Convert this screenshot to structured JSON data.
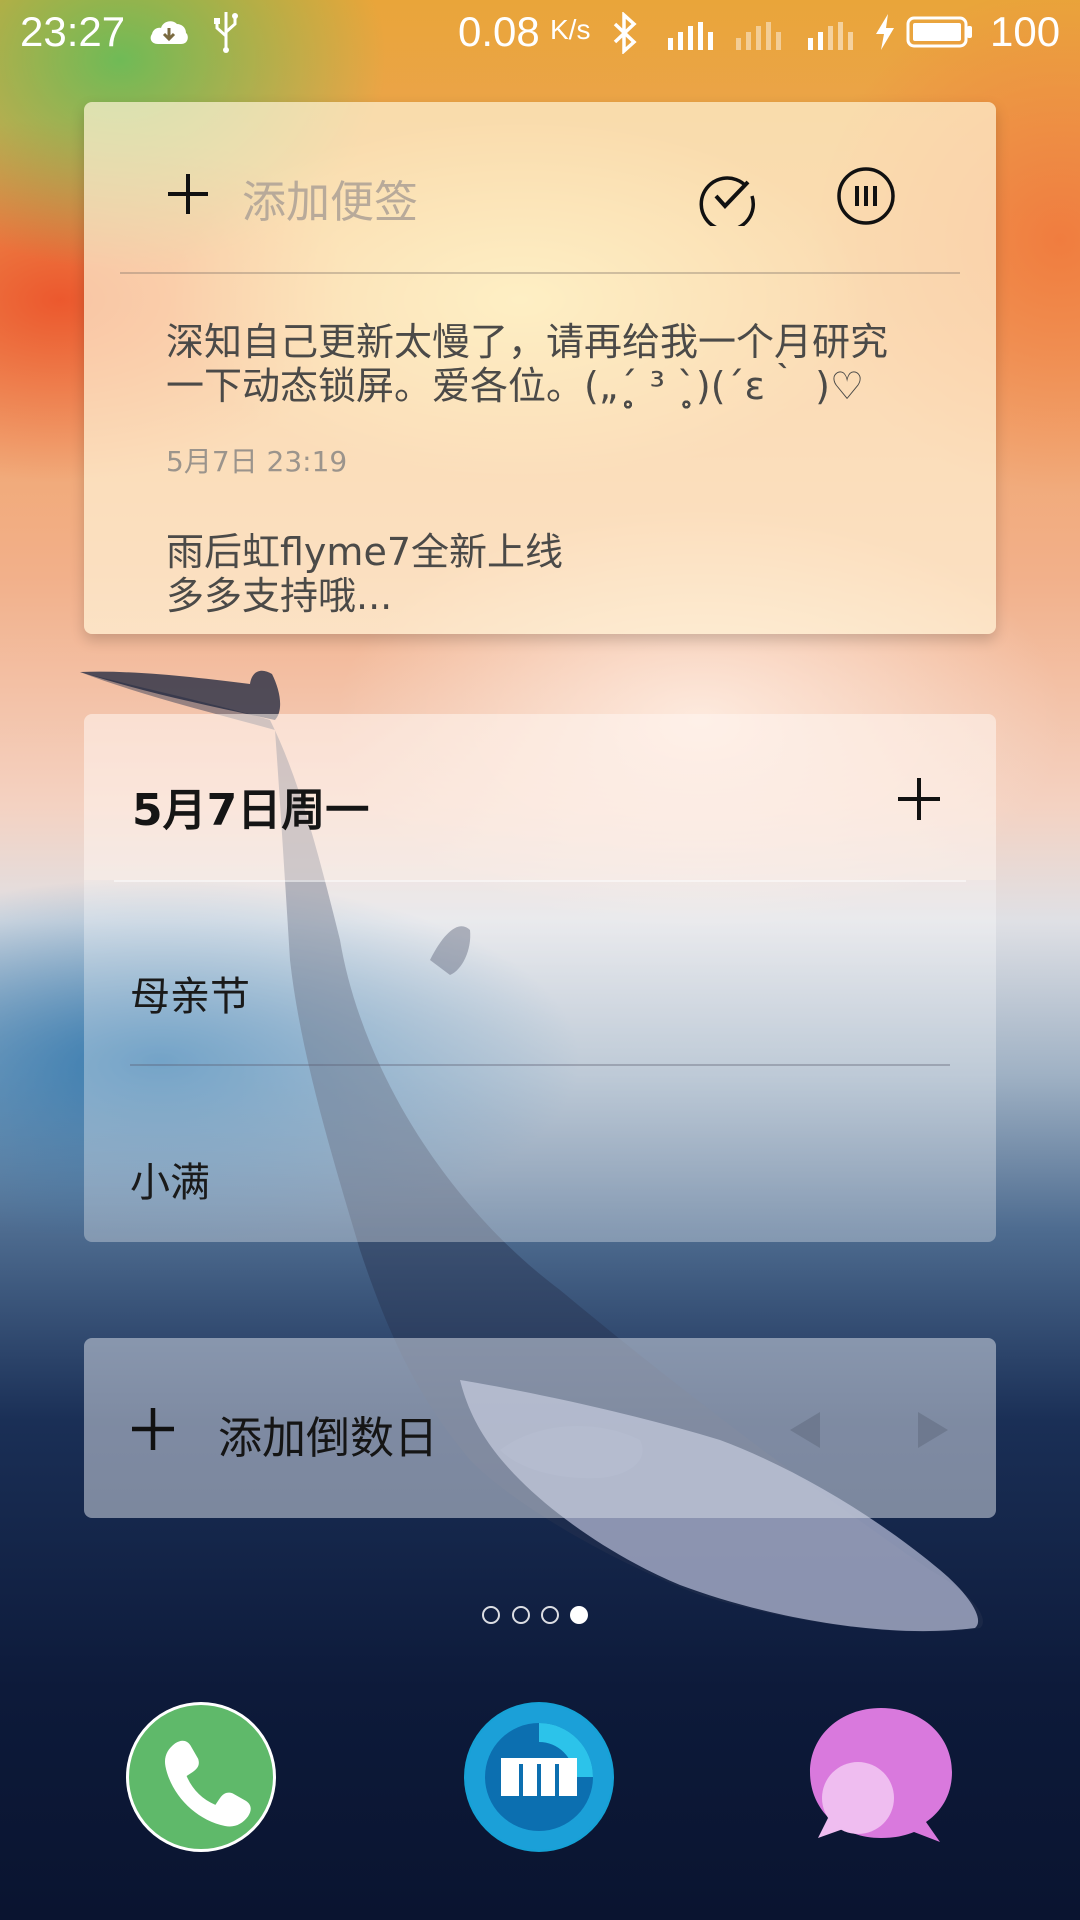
{
  "status_bar": {
    "time": "23:27",
    "speed": "0.08",
    "speed_unit": "K/s",
    "battery": "100",
    "icons": [
      "cloud-download-icon",
      "usb-icon",
      "bluetooth-icon",
      "signal-icon",
      "signal-empty-icon",
      "signal-4g-icon",
      "charging-icon",
      "battery-icon"
    ]
  },
  "notes_widget": {
    "add_placeholder": "添加便签",
    "notes": [
      {
        "line1": "深知自己更新太慢了，请再给我一个月研究",
        "line2": "一下动态锁屏。爱各位。(„ˊ̥̥̥̥̥ ³ ˋ̥̥̥̥̥)(´ε｀ )♡",
        "date": "5月7日  23:19"
      },
      {
        "line1": "雨后虹flyme7全新上线",
        "line2": "多多支持哦..."
      }
    ]
  },
  "calendar_widget": {
    "date_title": "5月7日周一",
    "events": [
      "母亲节",
      "小满"
    ]
  },
  "countdown_widget": {
    "add_label": "添加倒数日"
  },
  "pager": {
    "total": 4,
    "active_index": 3
  },
  "dock": {
    "apps": [
      "phone-app",
      "meizu-app",
      "messages-app"
    ]
  },
  "colors": {
    "phone_green": "#5fb96a",
    "meizu_blue": "#15a2d6",
    "message_pink": "#d979dd"
  }
}
